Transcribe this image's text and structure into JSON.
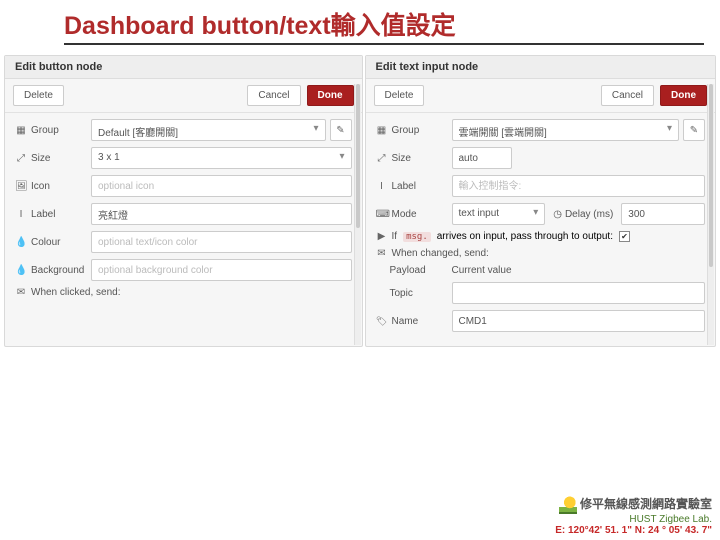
{
  "slide": {
    "title": "Dashboard  button/text輸入值設定"
  },
  "left": {
    "header": "Edit button node",
    "delete": "Delete",
    "cancel": "Cancel",
    "done": "Done",
    "labels": {
      "group": "Group",
      "size": "Size",
      "icon": "Icon",
      "label": "Label",
      "colour": "Colour",
      "background": "Background",
      "whenClicked": "When clicked, send:"
    },
    "values": {
      "group": "Default [客廳開關]",
      "size": "3 x 1",
      "label": "亮紅燈"
    },
    "placeholders": {
      "icon": "optional icon",
      "colour": "optional text/icon color",
      "background": "optional background color"
    }
  },
  "right": {
    "header": "Edit text input node",
    "delete": "Delete",
    "cancel": "Cancel",
    "done": "Done",
    "labels": {
      "group": "Group",
      "size": "Size",
      "label": "Label",
      "mode": "Mode",
      "delay": "Delay (ms)",
      "passThrough": "If",
      "passThroughMid": "arrives on input, pass through to output:",
      "whenChanged": "When changed, send:",
      "payload": "Payload",
      "payloadVal": "Current value",
      "topic": "Topic",
      "name": "Name"
    },
    "values": {
      "group": "雲端開關 [雲端開關]",
      "size": "auto",
      "mode": "text input",
      "delay": "300",
      "name": "CMD1",
      "msgPill": "msg."
    },
    "placeholders": {
      "label": "輸入控制指令:"
    }
  },
  "footer": {
    "labName": "修平無線感測網路實驗室",
    "labSub": "HUST Zigbee Lab.",
    "coord": "E: 120°42' 51. 1\"  N: 24 ° 05' 43. 7\""
  }
}
